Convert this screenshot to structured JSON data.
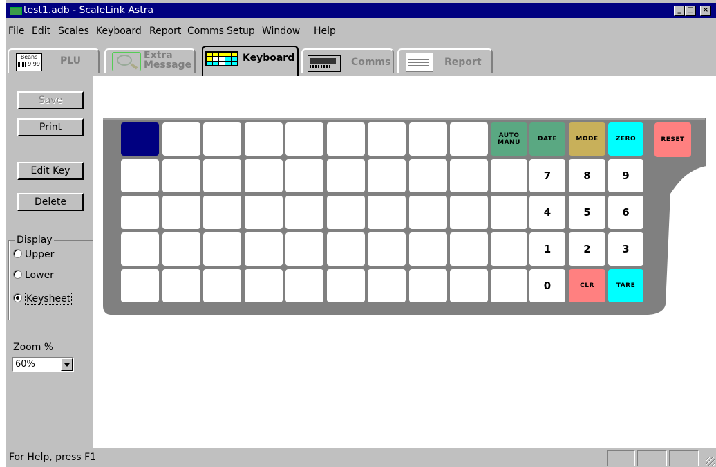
{
  "window": {
    "title": "test1.adb - ScaleLink Astra",
    "controls": [
      "_",
      "□",
      "×"
    ]
  },
  "menu": [
    "File",
    "Edit",
    "Scales",
    "Keyboard",
    "Report",
    "Comms",
    "Setup",
    "Window",
    "Help"
  ],
  "tabs": {
    "plu": {
      "label": "PLU",
      "icon_text_1": "Beans",
      "icon_text_2": "9.99"
    },
    "extra": {
      "label_1": "Extra",
      "label_2": "Message"
    },
    "keyboard": {
      "label": "Keyboard"
    },
    "comms": {
      "label": "Comms"
    },
    "report": {
      "label": "Report"
    }
  },
  "toolbar": {
    "save": "Save",
    "print": "Print",
    "edit_key": "Edit Key",
    "delete": "Delete"
  },
  "display": {
    "legend": "Display",
    "options": [
      "Upper",
      "Lower",
      "Keysheet"
    ],
    "selected": "Keysheet"
  },
  "zoom": {
    "label": "Zoom %",
    "value": "60%"
  },
  "keyboard": {
    "special_keys": {
      "auto_manu": "AUTO\nMANU",
      "date": "DATE",
      "mode": "MODE",
      "zero": "ZERO",
      "reset": "RESET",
      "clr": "CLR",
      "tare": "TARE"
    },
    "numpad": [
      "7",
      "8",
      "9",
      "4",
      "5",
      "6",
      "1",
      "2",
      "3",
      "0"
    ],
    "colors": {
      "selected": "#000080",
      "auto_manu": "#5aa882",
      "date": "#5aa882",
      "mode": "#c8b05a",
      "zero": "#00ffff",
      "reset": "#ff8080",
      "clr": "#ff8080",
      "tare": "#00ffff",
      "tray": "#808080"
    }
  },
  "status": {
    "text": "For Help, press F1"
  }
}
